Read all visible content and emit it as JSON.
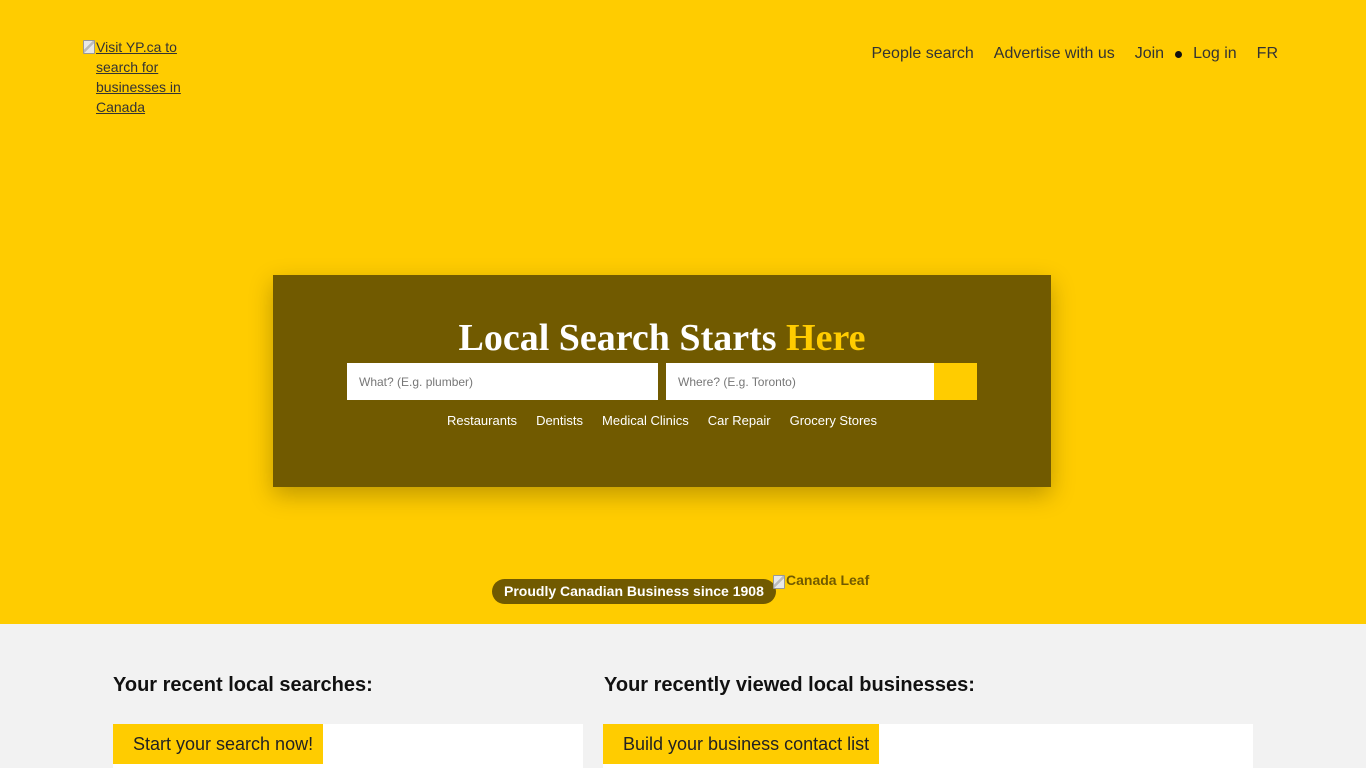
{
  "header": {
    "logo_alt": "Visit YP.ca to search for businesses in Canada",
    "nav": {
      "people_search": "People search",
      "advertise": "Advertise with us",
      "join": "Join",
      "login": "Log in",
      "language": "FR"
    }
  },
  "search": {
    "title_main": "Local Search Starts",
    "title_accent": "Here",
    "what_placeholder": "What? (E.g. plumber)",
    "where_placeholder": "Where? (E.g. Toronto)",
    "quick_links": [
      "Restaurants",
      "Dentists",
      "Medical Clinics",
      "Car Repair",
      "Grocery Stores"
    ]
  },
  "badge": {
    "text": "Proudly Canadian Business since 1908",
    "leaf_alt": "Canada Leaf"
  },
  "recent": {
    "searches_title": "Your recent local searches:",
    "searches_cta": "Start your search now!",
    "businesses_title": "Your recently viewed local businesses:",
    "businesses_cta": "Build your business contact list"
  },
  "colors": {
    "brand_yellow": "#ffcc00",
    "brand_brown": "#715a00",
    "page_grey": "#f2f2f2"
  }
}
